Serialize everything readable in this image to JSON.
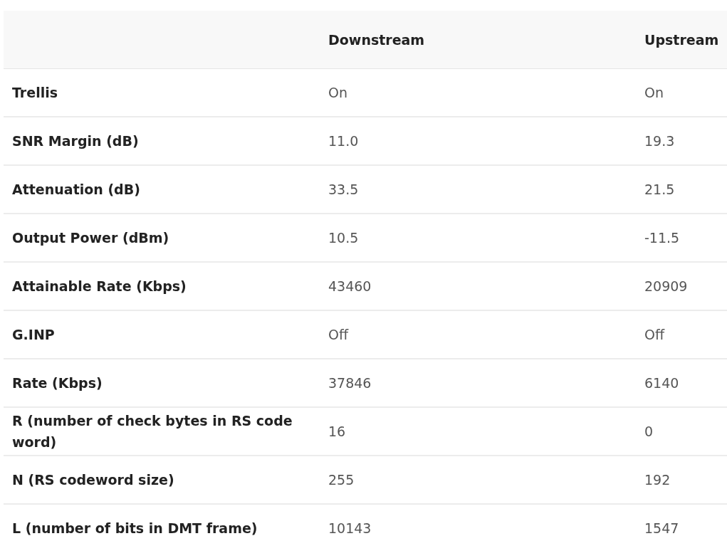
{
  "table": {
    "columns": [
      "",
      "Downstream",
      "Upstream"
    ],
    "rows": [
      {
        "label": "Trellis",
        "downstream": "On",
        "upstream": "On"
      },
      {
        "label": "SNR Margin (dB)",
        "downstream": "11.0",
        "upstream": "19.3"
      },
      {
        "label": "Attenuation (dB)",
        "downstream": "33.5",
        "upstream": "21.5"
      },
      {
        "label": "Output Power (dBm)",
        "downstream": "10.5",
        "upstream": "-11.5"
      },
      {
        "label": "Attainable Rate (Kbps)",
        "downstream": "43460",
        "upstream": "20909"
      },
      {
        "label": "G.INP",
        "downstream": "Off",
        "upstream": "Off"
      },
      {
        "label": "Rate (Kbps)",
        "downstream": "37846",
        "upstream": "6140"
      },
      {
        "label": "R (number of check bytes in RS code word)",
        "downstream": "16",
        "upstream": "0"
      },
      {
        "label": "N (RS codeword size)",
        "downstream": "255",
        "upstream": "192"
      },
      {
        "label": "L (number of bits in DMT frame)",
        "downstream": "10143",
        "upstream": "1547"
      }
    ]
  }
}
